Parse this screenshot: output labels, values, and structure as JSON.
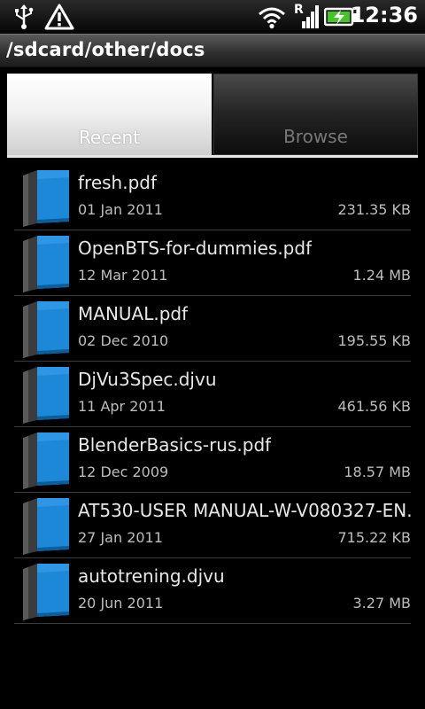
{
  "status_bar": {
    "time": "12:36",
    "icons": [
      "usb-icon",
      "warning-icon",
      "wifi-icon",
      "signal-roaming-icon",
      "battery-charging-icon"
    ],
    "roaming_letter": "R"
  },
  "path": "/sdcard/other/docs",
  "tabs": [
    {
      "label": "Recent",
      "selected": true
    },
    {
      "label": "Browse",
      "selected": false
    }
  ],
  "files": [
    {
      "name": "fresh.pdf",
      "date": "01 Jan 2011",
      "size": "231.35 KB"
    },
    {
      "name": "OpenBTS-for-dummies.pdf",
      "date": "12 Mar 2011",
      "size": "1.24 MB"
    },
    {
      "name": "MANUAL.pdf",
      "date": "02 Dec 2010",
      "size": "195.55 KB"
    },
    {
      "name": "DjVu3Spec.djvu",
      "date": "11 Apr 2011",
      "size": "461.56 KB"
    },
    {
      "name": "BlenderBasics-rus.pdf",
      "date": "12 Dec 2009",
      "size": "18.57 MB"
    },
    {
      "name": "AT530-USER MANUAL-W-V080327-EN...",
      "date": "27 Jan 2011",
      "size": "715.22 KB"
    },
    {
      "name": "autotrening.djvu",
      "date": "20 Jun 2011",
      "size": "3.27 MB"
    }
  ],
  "colors": {
    "book_cover": "#1e88d8",
    "book_spine": "#4a4a4a",
    "divider": "#3a3a3a"
  }
}
